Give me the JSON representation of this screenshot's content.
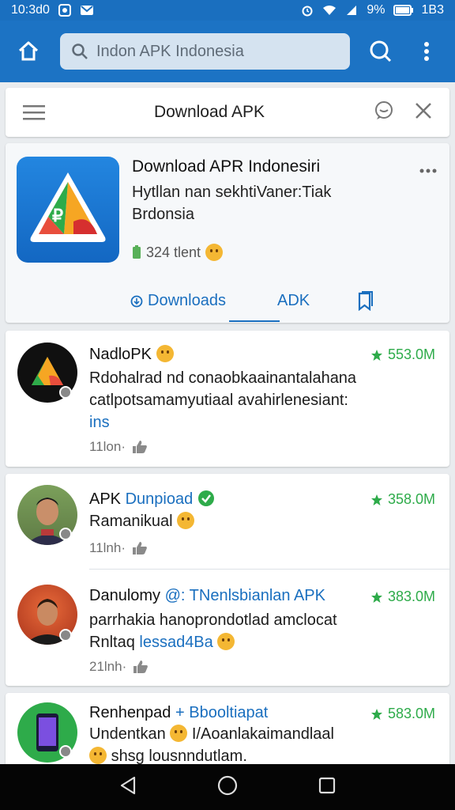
{
  "status_bar": {
    "time": "10:3d0",
    "battery_text": "9%",
    "extra": "1B3"
  },
  "search": {
    "placeholder": "Indon APK Indonesia"
  },
  "title_card": {
    "title": "Download APK"
  },
  "hero": {
    "title": "Download APR Indonesiri",
    "subtitle_line1": "Hytllan nan sekhtiVaner:Tiak",
    "subtitle_line2": "Brdonsia",
    "meta": "324 tlent",
    "tabs": [
      {
        "label": "Downloads",
        "icon": "download-circle-icon"
      },
      {
        "label": "ADK"
      },
      {
        "icon": "bookmark-icon"
      }
    ]
  },
  "posts": [
    {
      "name": "NadloPK",
      "rating": "553.0M",
      "body_line1": "Rdohalrad nd conaobkaainantalahana",
      "body_line2": "catlpotsamamyutiaal avahirlenesiant:",
      "body_link": "ins",
      "time": "11lon·"
    },
    {
      "name_prefix": "APK",
      "name_blue": "Dunpioad",
      "rating": "358.0M",
      "body_line1": "Ramanikual",
      "time": "11lnh·"
    },
    {
      "name": "Danulomy",
      "name_blue": "@: TNenlsbianlan APK",
      "rating": "383.0M",
      "body_line1": "parrhakia hanoprondotlad amclocat",
      "body_line2_prefix": "Rnltaq",
      "body_line2_blue": "lessad4Ba",
      "time": "21lnh·"
    },
    {
      "name": "Renhenpad",
      "name_blue": "+ Bbooltiapat",
      "rating": "583.0M",
      "body_line1_prefix": "Undentkan",
      "body_line1_rest": "I/Aoanlakaimandlaal",
      "body_line2": "shsg lousnndutlam."
    }
  ],
  "colors": {
    "primary": "#1c73c4",
    "rating_green": "#2eab4a",
    "link_blue": "#1a6fbf"
  }
}
